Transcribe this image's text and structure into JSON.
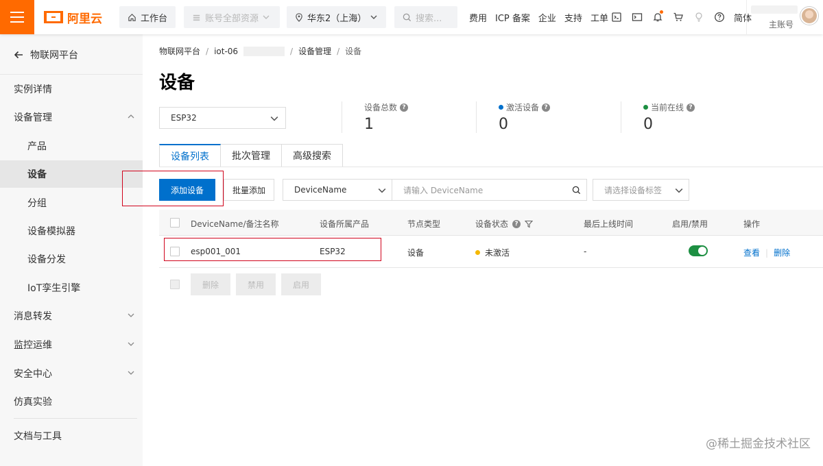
{
  "topbar": {
    "logo_text": "阿里云",
    "workbench": "工作台",
    "resources": "账号全部资源",
    "region": "华东2（上海）",
    "search_placeholder": "搜索...",
    "links": [
      "费用",
      "ICP 备案",
      "企业",
      "支持",
      "工单"
    ],
    "language": "简体",
    "user_role": "主账号"
  },
  "sidebar": {
    "back_label": "物联网平台",
    "items": [
      {
        "label": "实例详情"
      },
      {
        "label": "设备管理"
      },
      {
        "label": "产品"
      },
      {
        "label": "设备"
      },
      {
        "label": "分组"
      },
      {
        "label": "设备模拟器"
      },
      {
        "label": "设备分发"
      },
      {
        "label": "IoT孪生引擎"
      },
      {
        "label": "消息转发"
      },
      {
        "label": "监控运维"
      },
      {
        "label": "安全中心"
      },
      {
        "label": "仿真实验"
      },
      {
        "label": "文档与工具"
      }
    ]
  },
  "breadcrumb": {
    "items": [
      "物联网平台",
      "iot-06",
      "设备管理",
      "设备"
    ]
  },
  "page": {
    "title": "设备",
    "product_value": "ESP32"
  },
  "stats": [
    {
      "label": "设备总数",
      "value": "1"
    },
    {
      "label": "激活设备",
      "value": "0"
    },
    {
      "label": "当前在线",
      "value": "0"
    }
  ],
  "tabs": [
    "设备列表",
    "批次管理",
    "高级搜索"
  ],
  "toolbar": {
    "add_device": "添加设备",
    "batch_add": "批量添加",
    "search_type": "DeviceName",
    "search_placeholder": "请输入 DeviceName",
    "tag_placeholder": "请选择设备标签"
  },
  "table": {
    "headers": [
      "DeviceName/备注名称",
      "设备所属产品",
      "节点类型",
      "设备状态",
      "最后上线时间",
      "启用/禁用",
      "操作"
    ],
    "rows": [
      {
        "name": "esp001_001",
        "product": "ESP32",
        "node_type": "设备",
        "status": "未激活",
        "last_online": "-",
        "enabled": true,
        "actions": [
          "查看",
          "删除"
        ]
      }
    ]
  },
  "bulk_actions": [
    "删除",
    "禁用",
    "启用"
  ],
  "watermark": "@稀土掘金技术社区",
  "colors": {
    "brand": "#ff6a00",
    "primary": "#0070cc",
    "highlight": "#d0021b",
    "status_inactive": "#f5b800",
    "toggle_on": "#1d8f42"
  }
}
